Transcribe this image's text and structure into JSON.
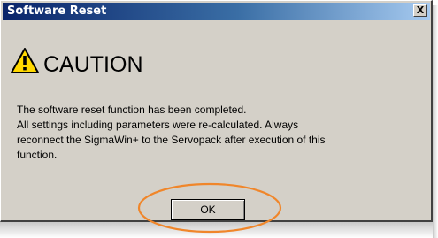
{
  "window": {
    "title": "Software Reset",
    "close_label": "X"
  },
  "caution": {
    "heading": "CAUTION",
    "icon": "warning-triangle-icon",
    "icon_color": "#ffd800"
  },
  "message": {
    "lines": [
      "The software reset function has been completed.",
      "All settings including parameters were re-calculated. Always",
      "reconnect the SigmaWin+ to the Servopack after execution of this",
      "function."
    ]
  },
  "buttons": {
    "ok_label": "OK"
  },
  "annotation": {
    "highlight_color": "#f0862a"
  }
}
